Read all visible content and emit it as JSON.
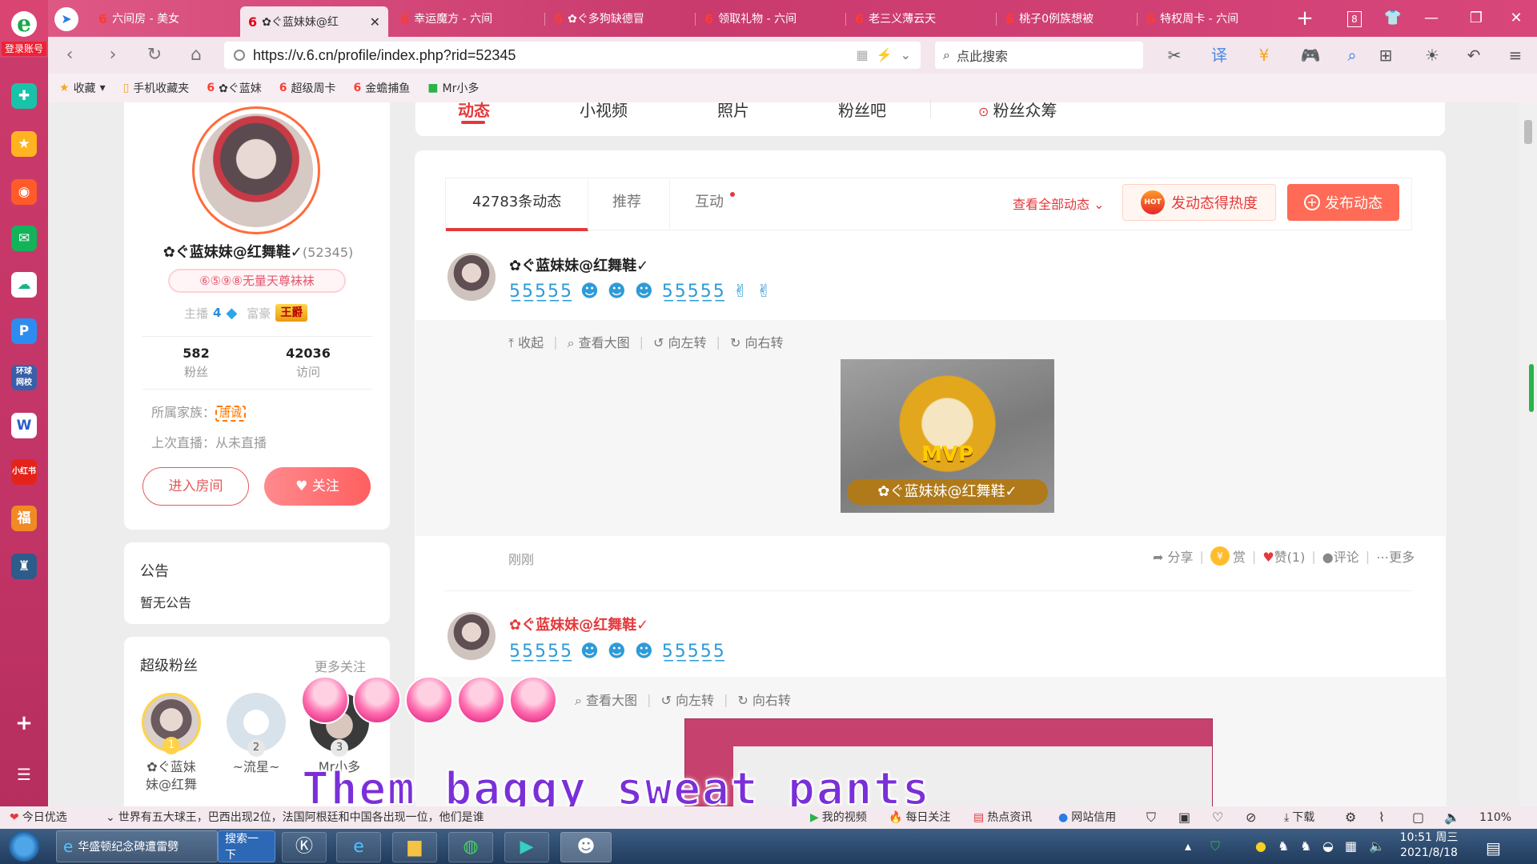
{
  "browser": {
    "login_label": "登录账号",
    "tabs": [
      {
        "label": "六间房 - 美女"
      },
      {
        "label": "✿ぐ蓝妹妹@红",
        "active": true
      },
      {
        "label": "幸运魔方 - 六间"
      },
      {
        "label": "✿ぐ多狗缺德冒"
      },
      {
        "label": "领取礼物 - 六间"
      },
      {
        "label": "老三义薄云天"
      },
      {
        "label": "桃子0例族想被"
      },
      {
        "label": "特权周卡 - 六间"
      }
    ],
    "tab_count": "8",
    "url": "https://v.6.cn/profile/index.php?rid=52345",
    "search_placeholder": "点此搜索",
    "bookmarks": [
      "收藏",
      "手机收藏夹",
      "✿ぐ蓝妹",
      "超级周卡",
      "金蟾捕鱼",
      "Mr小多"
    ]
  },
  "profile": {
    "name": "✿ぐ蓝妹妹@红舞鞋✓",
    "rid": "(52345)",
    "pill": "⑥⑤⑨⑧无量天尊袜袜",
    "anchor_label": "主播",
    "anchor_level": "4",
    "rich_label": "富豪",
    "rich_badge": "王爵",
    "fans_count": "582",
    "fans_label": "粉丝",
    "visits_count": "42036",
    "visits_label": "访问",
    "family_label": "所属家族：",
    "family_name": "唐诚",
    "last_live": "上次直播：从未直播",
    "enter_room": "进入房间",
    "follow": "关注"
  },
  "notice": {
    "title": "公告",
    "text": "暂无公告"
  },
  "super_fans": {
    "title": "超级粉丝",
    "more": "更多关注",
    "fans": [
      {
        "rank": "1",
        "name": "✿ぐ蓝妹\n妹@红舞"
      },
      {
        "rank": "2",
        "name": "~流星~"
      },
      {
        "rank": "3",
        "name": "Mr小多"
      }
    ]
  },
  "topnav": [
    "动态",
    "小视频",
    "照片",
    "粉丝吧",
    "粉丝众筹"
  ],
  "feed": {
    "tabs": [
      "42783条动态",
      "推荐",
      "互动"
    ],
    "view_all": "查看全部动态",
    "hot_button": "发动态得热度",
    "hot_badge": "HOT",
    "post_button": "发布动态",
    "posts": [
      {
        "author": "✿ぐ蓝妹妹@红舞鞋✓",
        "emoji_line": "5̲5̲5̲5̲5̲ ☻ ☻ ☻ 5̲5̲5̲5̲5̲ ✌ ✌",
        "actions": [
          "收起",
          "查看大图",
          "向左转",
          "向右转"
        ],
        "image_text": "MVP",
        "image_banner": "✿ぐ蓝妹妹@红舞鞋✓",
        "time": "刚刚",
        "meta": [
          "分享",
          "赏",
          "赞(1)",
          "评论",
          "更多"
        ]
      },
      {
        "author": "✿ぐ蓝妹妹@红舞鞋✓",
        "emoji_line": "5̲5̲5̲5̲5̲ ☻ ☻ ☻ 5̲5̲5̲5̲5̲",
        "actions": [
          "查看大图",
          "向左转",
          "向右转"
        ]
      }
    ]
  },
  "overlay": {
    "caption": "Them baggy sweat pants"
  },
  "statusbar": {
    "left": "今日优选",
    "news": "世界有五大球王，巴西出现2位，法国阿根廷和中国各出现一位，他们是谁",
    "items": [
      "我的视频",
      "每日关注",
      "热点资讯",
      "网站信用",
      "下载"
    ],
    "zoom": "110%"
  },
  "taskbar": {
    "ie_task": "华盛顿纪念碑遭雷劈",
    "search_task": "搜索一下",
    "time": "10:51 周三",
    "date": "2021/8/18"
  }
}
